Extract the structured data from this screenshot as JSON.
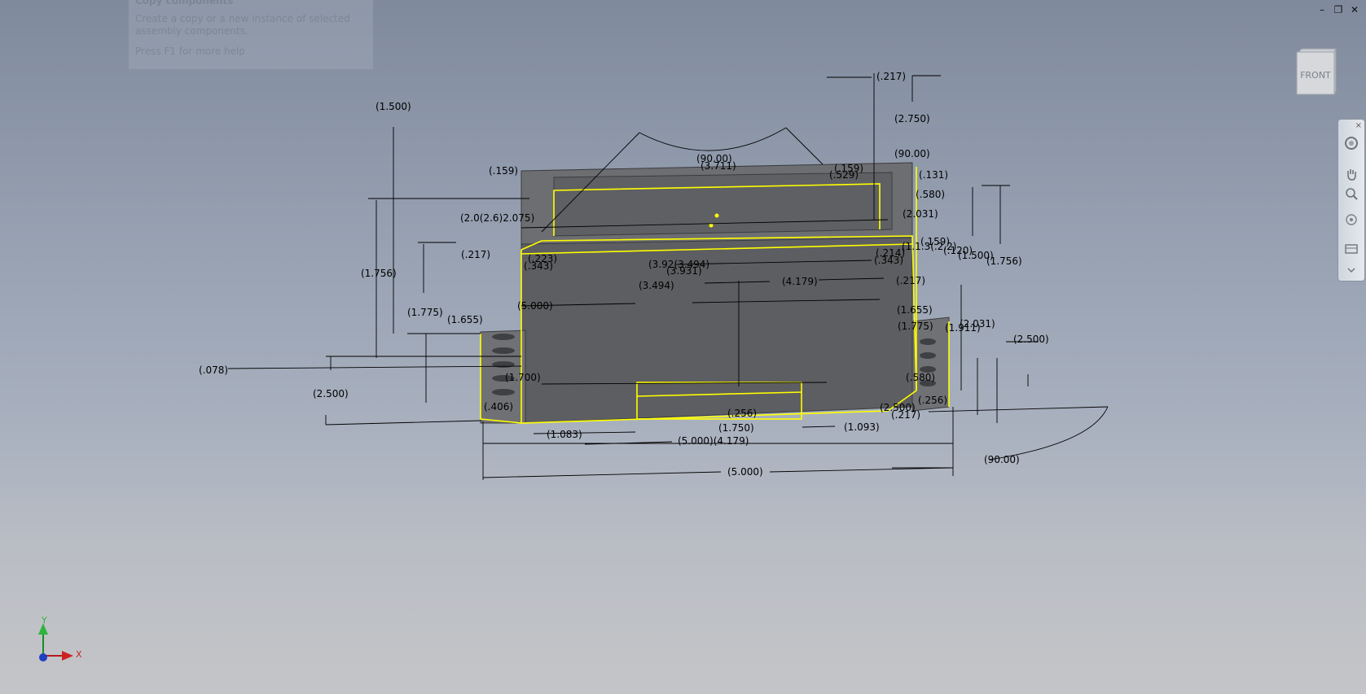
{
  "tooltip": {
    "title": "Copy components",
    "description": "Create a copy or a new instance of selected assembly components.",
    "help": "Press F1 for more help"
  },
  "window_controls": {
    "minimize": "–",
    "restore": "❐",
    "close": "✕"
  },
  "viewcube": {
    "face_label": "FRONT"
  },
  "navbar": {
    "close": "×"
  },
  "triad": {
    "x": "X",
    "y": "Y"
  },
  "colors": {
    "accent_selection": "#ffff00",
    "part_body": "#5d5e61",
    "part_top": "#7e8084"
  },
  "dimensions": {
    "d1": "(.217)",
    "d2": "(2.750)",
    "d3": "(1.500)",
    "d4": "(90.00)",
    "d5": "(3.711)",
    "d6": "(.159)",
    "d7": "(.159)",
    "d8": "(.529)",
    "d9": "(90.00)",
    "d10": "(.131)",
    "d11": "(2.0(2.6)2.075)",
    "d12": "(.580)",
    "d13": "(2.031)",
    "d14": "(.217)",
    "d15": "(.223)",
    "d16": "(.343)",
    "d17": "(3.92(3.494)",
    "d18": "(3.931)",
    "d19": "(.214)",
    "d20": "(.343)",
    "d21": "(.159)",
    "d22": "(1.500)",
    "d23": "(1.756)",
    "d24": "(1.756)",
    "d25": "(3.494)",
    "d26": "(4.179)",
    "d27": "(.217)",
    "d28": "(.120)",
    "d29": "(5.000)",
    "d30": "(1.775)",
    "d31": "(1.655)",
    "d32": "(1.655)",
    "d33": "(1.775)",
    "d34": "(1.911)",
    "d35": "(2.031)",
    "d36": "(2.500)",
    "d37": "(.078)",
    "d38": "(1.700)",
    "d39": "(.580)",
    "d40": "(2.500)",
    "d41": "(.406)",
    "d42": "(.256)",
    "d43": "(2.500)",
    "d44": "(.256)",
    "d45": "(.217)",
    "d46": "(1.750)",
    "d47": "(1.093)",
    "d48": "(1.083)",
    "d49": "(5.000)(4.179)",
    "d50": "(90.00)",
    "d51": "(5.000)",
    "d52": "(1.1.3(.2.2)"
  }
}
